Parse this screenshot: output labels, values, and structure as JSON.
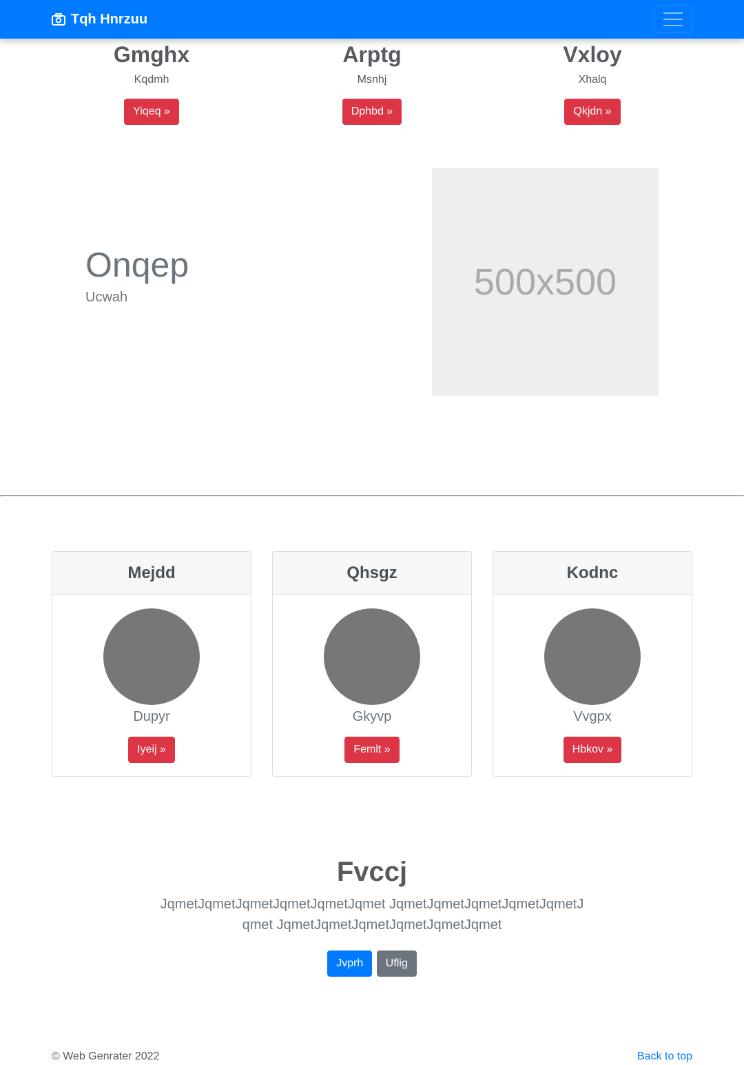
{
  "navbar": {
    "brand": "Tqh Hnrzuu",
    "bg_color": "#007bff",
    "brand_icon": "camera-icon",
    "toggler_icon": "hamburger-icon"
  },
  "top_columns": [
    {
      "title": "Gmghx",
      "text": "Kqdmh",
      "button": "Yiqeq »"
    },
    {
      "title": "Arptg",
      "text": "Msnhj",
      "button": "Dphbd »"
    },
    {
      "title": "Vxloy",
      "text": "Xhalq",
      "button": "Qkjdn »"
    }
  ],
  "feature": {
    "title": "Onqep",
    "subtitle": "Ucwah",
    "image_label": "500x500"
  },
  "cards": [
    {
      "header": "Mejdd",
      "text": "Dupyr",
      "button": "Iyeij »"
    },
    {
      "header": "Qhsgz",
      "text": "Gkyvp",
      "button": "Femlt »"
    },
    {
      "header": "Kodnc",
      "text": "Vvgpx",
      "button": "Hbkov »"
    }
  ],
  "jumbotron": {
    "title": "Fvccj",
    "text": "JqmetJqmetJqmetJqmetJqmetJqmet JqmetJqmetJqmetJqmetJqmetJqmet JqmetJqmetJqmetJqmetJqmetJqmet",
    "primary_button": "Jvprh",
    "secondary_button": "Uflig"
  },
  "footer": {
    "copyright": "© Web Genrater 2022",
    "back_to_top": "Back to top"
  },
  "colors": {
    "primary": "#007bff",
    "danger": "#dc3545",
    "secondary": "#6c757d"
  }
}
